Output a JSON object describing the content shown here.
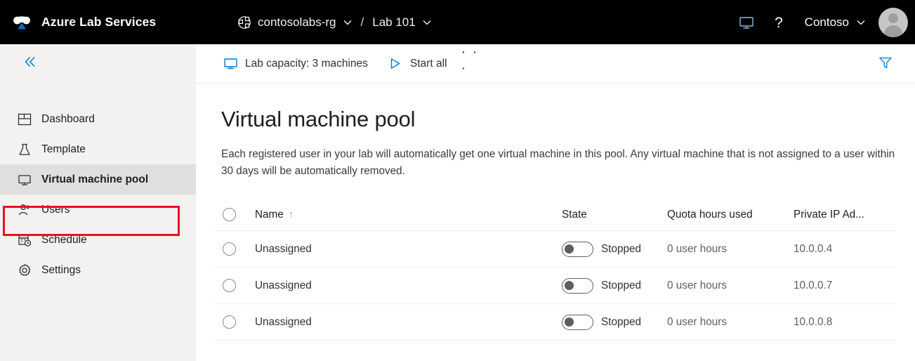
{
  "topbar": {
    "logo_icon": "azure-logo-icon",
    "brand": "Azure Lab Services",
    "resource_group_icon": "resource-group-icon",
    "resource_group": "contosolabs-rg",
    "separator": "/",
    "lab_name": "Lab 101",
    "chevron_icon": "chevron-down-icon",
    "monitor_icon": "monitor-icon",
    "help_icon": "help-question-icon",
    "tenant": "Contoso",
    "avatar_icon": "user-avatar-icon"
  },
  "sidebar": {
    "collapse_icon": "double-chevron-left-icon",
    "items": [
      {
        "label": "Dashboard",
        "icon": "dashboard-icon",
        "selected": false
      },
      {
        "label": "Template",
        "icon": "flask-icon",
        "selected": false
      },
      {
        "label": "Virtual machine pool",
        "icon": "monitor-icon",
        "selected": true
      },
      {
        "label": "Users",
        "icon": "user-icon",
        "selected": false
      },
      {
        "label": "Schedule",
        "icon": "calendar-clock-icon",
        "selected": false
      },
      {
        "label": "Settings",
        "icon": "gear-icon",
        "selected": false
      }
    ],
    "highlight_color": "#e81123"
  },
  "commandbar": {
    "capacity_icon": "monitor-icon",
    "capacity_label": "Lab capacity: 3 machines",
    "start_icon": "play-triangle-icon",
    "start_label": "Start all",
    "overflow_label": "· · ·",
    "filter_icon": "filter-funnel-icon",
    "filter_color": "#0078d4"
  },
  "main": {
    "title": "Virtual machine pool",
    "description": "Each registered user in your lab will automatically get one virtual machine in this pool. Any virtual machine that is not assigned to a user within 30 days will be automatically removed."
  },
  "table": {
    "select_all_icon": "radio-unchecked-icon",
    "columns": {
      "name": "Name",
      "sort_indicator": "↑",
      "state": "State",
      "quota": "Quota hours used",
      "ip": "Private IP Ad..."
    },
    "rows": [
      {
        "name": "Unassigned",
        "state": "Stopped",
        "toggle": "off",
        "quota": "0 user hours",
        "ip": "10.0.0.4"
      },
      {
        "name": "Unassigned",
        "state": "Stopped",
        "toggle": "off",
        "quota": "0 user hours",
        "ip": "10.0.0.7"
      },
      {
        "name": "Unassigned",
        "state": "Stopped",
        "toggle": "off",
        "quota": "0 user hours",
        "ip": "10.0.0.8"
      }
    ]
  }
}
